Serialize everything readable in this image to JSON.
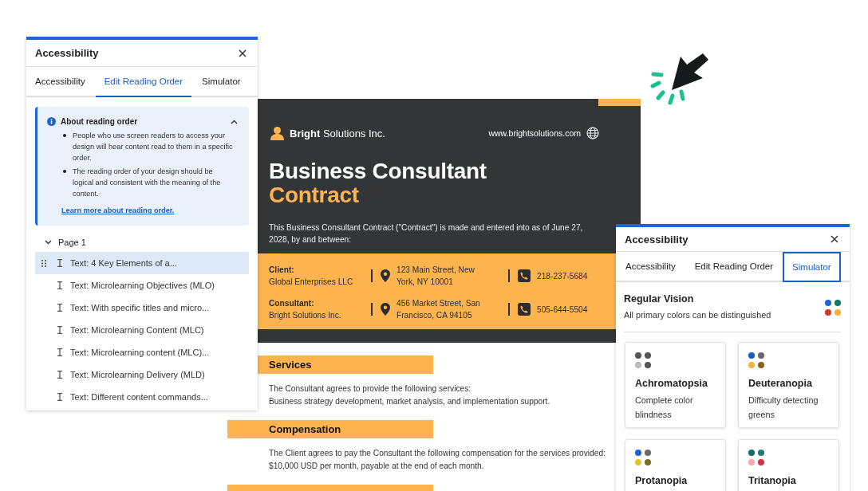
{
  "reading_panel": {
    "title": "Accessibility",
    "tabs": [
      {
        "label": "Accessibility",
        "selected": false
      },
      {
        "label": "Edit Reading Order",
        "selected": true
      },
      {
        "label": "Simulator",
        "selected": false
      }
    ],
    "info": {
      "title": "About reading order",
      "expanded": true,
      "bullets": [
        "People who use screen readers to access your design will hear content read to them in a specific order.",
        "The reading order of your design should be logical and consistent with the meaning of the content."
      ],
      "link": "Learn more about reading order."
    },
    "page": {
      "label": "Page 1",
      "expanded": true,
      "items": [
        {
          "label": "Text: 4 Key Elements of a...",
          "selected": true
        },
        {
          "label": "Text: Microlearning Objectives (MLO)",
          "selected": false
        },
        {
          "label": "Text: With specific titles and micro...",
          "selected": false
        },
        {
          "label": "Text: Microlearning Content (MLC)",
          "selected": false
        },
        {
          "label": "Text: Microlearning content (MLC)...",
          "selected": false
        },
        {
          "label": "Text: Microlearning Delivery (MLD)",
          "selected": false
        },
        {
          "label": "Text: Different content commands...",
          "selected": false
        }
      ]
    }
  },
  "document": {
    "company": "**Bright** Solutions Inc.",
    "website": "www.brightsolutions.com",
    "title": "Business Consultant",
    "title_accent": "Contract",
    "intro": "This Business Consultant Contract (\"Contract\") is made and entered into as of June 27, 2028, by and between:",
    "parties": [
      {
        "role": "Client:",
        "name": "Global Enterprises LLC",
        "address": "123 Main Street, New York, NY 10001",
        "phone": "218-237-5684"
      },
      {
        "role": "Consultant:",
        "name": "Bright Solutions Inc.",
        "address": "456 Market Street, San Francisco, CA 94105",
        "phone": "505-644-5504"
      }
    ],
    "sections": [
      {
        "heading": "Services",
        "body": "The Consultant agrees to provide the following services:\nBusiness strategy development, market analysis, and implementation support."
      },
      {
        "heading": "Compensation",
        "body": "The Client agrees to pay the Consultant the following compensation for the services provided: $10,000 USD per month, payable at the end of each month."
      }
    ]
  },
  "simulator_panel": {
    "title": "Accessibility",
    "tabs": [
      {
        "label": "Accessibility",
        "selected": false
      },
      {
        "label": "Edit Reading Order",
        "selected": false
      },
      {
        "label": "Simulator",
        "selected": true
      }
    ],
    "current": {
      "title": "Regular Vision",
      "description": "All primary colors can be distinguished",
      "dots": [
        {
          "color": "#1a66d9"
        },
        {
          "color": "#0e7a5e"
        },
        {
          "color": "#d23a1f"
        },
        {
          "color": "#f4b328"
        }
      ]
    },
    "modes": [
      {
        "name": "Achromatopsia",
        "description": "Complete color blindness",
        "dots": [
          {
            "color": "#555555"
          },
          {
            "color": "#555555"
          },
          {
            "color": "#bbbbbb"
          },
          {
            "color": "#555555"
          }
        ]
      },
      {
        "name": "Deuteranopia",
        "description": "Difficulty detecting greens",
        "dots": [
          {
            "color": "#1060c8"
          },
          {
            "color": "#6e6470"
          },
          {
            "color": "#f4b43c"
          },
          {
            "color": "#8a6416"
          }
        ]
      },
      {
        "name": "Protanopia",
        "dots": [
          {
            "color": "#2060d8"
          },
          {
            "color": "#716a60"
          },
          {
            "color": "#e3c52f"
          },
          {
            "color": "#7c6a25"
          }
        ]
      },
      {
        "name": "Tritanopia",
        "dots": [
          {
            "color": "#0e706a"
          },
          {
            "color": "#2a7876"
          },
          {
            "color": "#f4a8b4"
          },
          {
            "color": "#d23140"
          }
        ]
      }
    ]
  }
}
